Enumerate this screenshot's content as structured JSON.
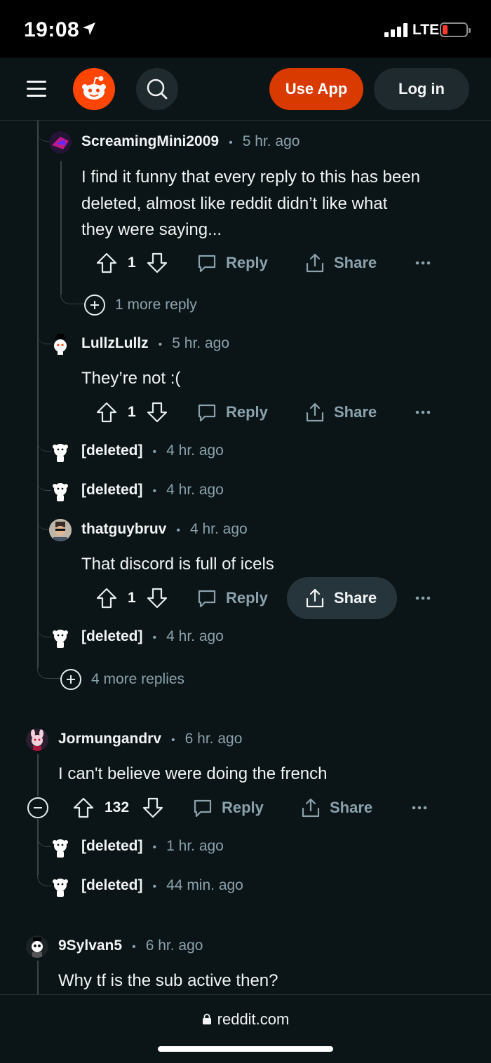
{
  "status_bar": {
    "time": "19:08",
    "network": "LTE"
  },
  "header": {
    "menu_icon": "hamburger-icon",
    "logo_icon": "reddit-logo-icon",
    "search_icon": "search-icon",
    "use_app_label": "Use App",
    "login_label": "Log in",
    "accent": "#ff4500",
    "use_app_color": "#d93a00"
  },
  "comments": [
    {
      "user": "ScreamingMini2009",
      "ago": "5 hr. ago",
      "body_lines": [
        "I find it funny that every reply to this has been",
        "deleted, almost like reddit didn’t like what",
        "they were saying..."
      ],
      "score": "1",
      "reply_label": "Reply",
      "share_label": "Share",
      "more_replies": "1 more reply"
    },
    {
      "user": "LullzLullz",
      "ago": "5 hr. ago",
      "body": "They’re not :(",
      "score": "1",
      "reply_label": "Reply",
      "share_label": "Share"
    },
    {
      "user": "[deleted]",
      "ago": "4 hr. ago"
    },
    {
      "user": "[deleted]",
      "ago": "4 hr. ago"
    },
    {
      "user": "thatguybruv",
      "ago": "4 hr. ago",
      "body": "That discord is full of icels",
      "score": "1",
      "reply_label": "Reply",
      "share_label": "Share"
    },
    {
      "user": "[deleted]",
      "ago": "4 hr. ago"
    },
    {
      "more_replies": "4 more replies"
    },
    {
      "user": "Jormungandrv",
      "ago": "6 hr. ago",
      "body": "I can't believe were doing the french",
      "score": "132",
      "reply_label": "Reply",
      "share_label": "Share"
    },
    {
      "user": "[deleted]",
      "ago": "1 hr. ago"
    },
    {
      "user": "[deleted]",
      "ago": "44 min. ago"
    },
    {
      "user": "9Sylvan5",
      "ago": "6 hr. ago",
      "body": "Why tf is the sub active then?"
    }
  ],
  "bottom_bar": {
    "url": "reddit.com",
    "lock_icon": "lock-icon"
  }
}
